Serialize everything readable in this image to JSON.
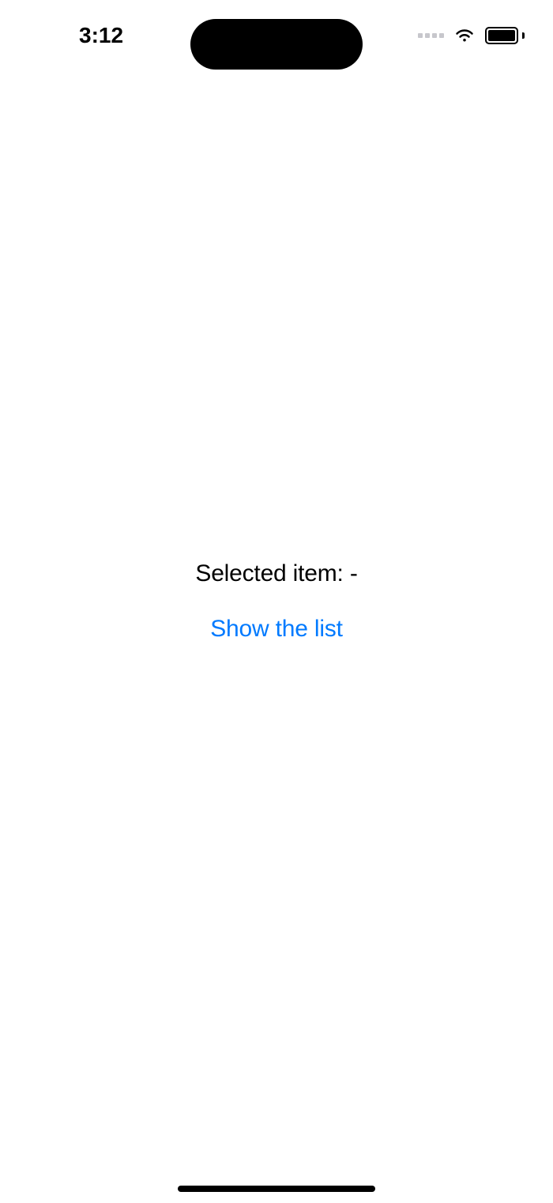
{
  "statusBar": {
    "time": "3:12"
  },
  "main": {
    "selectedItemLabel": "Selected item:  -",
    "showListButton": "Show the list"
  }
}
